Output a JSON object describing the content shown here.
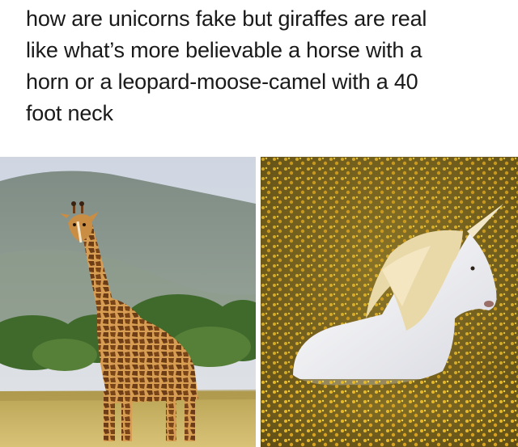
{
  "caption": {
    "lines": [
      "how are unicorns fake but giraffes are real",
      "like what’s more believable a horse with a",
      "horn or a leopard-moose-camel with a 40",
      "foot neck"
    ]
  },
  "images": {
    "left": {
      "subject": "giraffe-photo"
    },
    "right": {
      "subject": "unicorn-photo"
    }
  },
  "colors": {
    "background": "#ffffff",
    "text": "#1a1a1a",
    "sky": "#d9dde6",
    "mountain": "#8a9a8c",
    "grass": "#c9b15e",
    "giraffe_coat": "#c8893f",
    "giraffe_patch": "#6b3c16",
    "meadow": "#8a6a1c",
    "flowers": "#e5b81f",
    "unicorn": "#f1f1f4",
    "mane": "#e8d6a6"
  }
}
